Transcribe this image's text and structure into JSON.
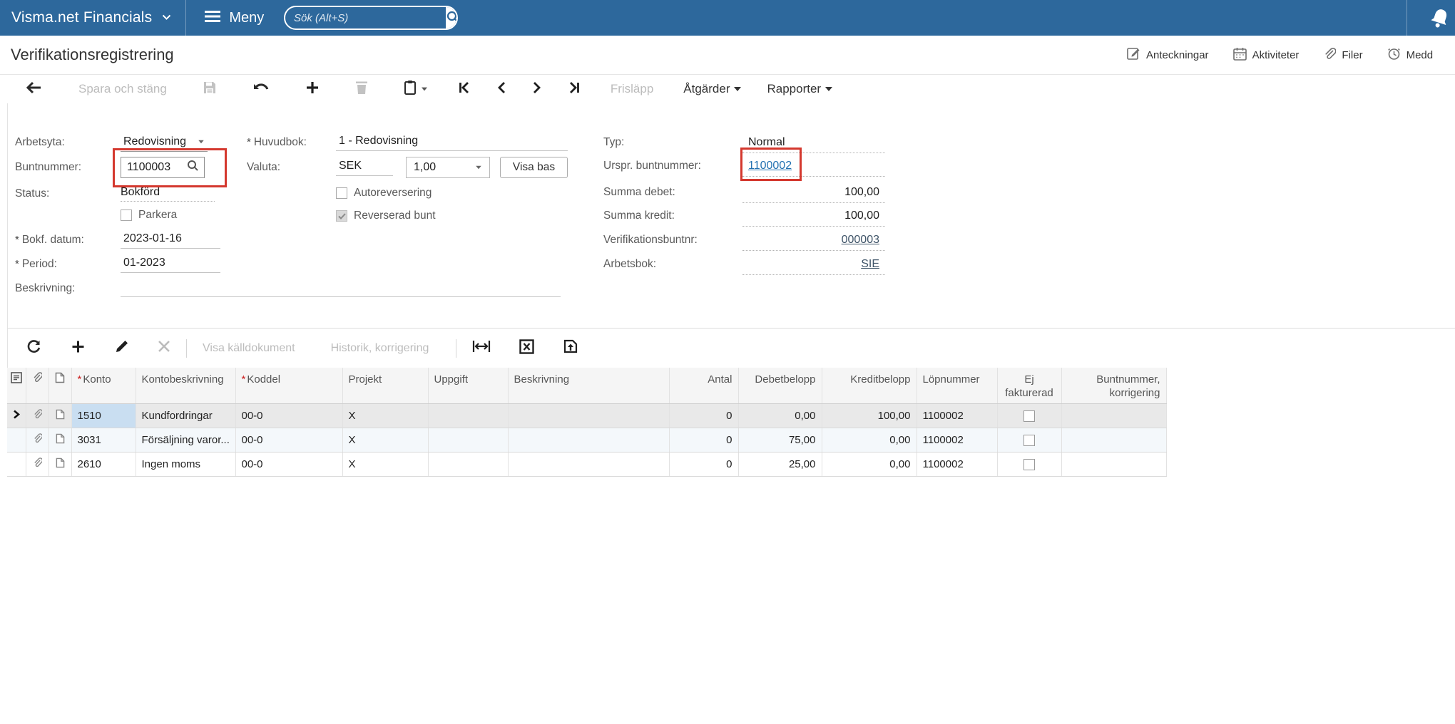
{
  "topbar": {
    "brand": "Visma.net Financials",
    "menu_label": "Meny",
    "search_placeholder": "Sök (Alt+S)"
  },
  "titlebar": {
    "title": "Verifikationsregistrering",
    "notes_label": "Anteckningar",
    "activities_label": "Aktiviteter",
    "files_label": "Filer",
    "messages_label": "Medd"
  },
  "toolbar": {
    "save_close_label": "Spara och stäng",
    "release_label": "Frisläpp",
    "actions_label": "Åtgärder",
    "reports_label": "Rapporter"
  },
  "misc": {
    "required_mark": "*"
  },
  "form": {
    "left": {
      "arbetsyta_label": "Arbetsyta:",
      "arbetsyta_value": "Redovisning",
      "buntnummer_label": "Buntnummer:",
      "buntnummer_value": "1100003",
      "status_label": "Status:",
      "status_value": "Bokförd",
      "parkera_label": "Parkera",
      "bokf_datum_label": "Bokf. datum:",
      "bokf_datum_value": "2023-01-16",
      "period_label": "Period:",
      "period_value": "01-2023",
      "beskrivning_label": "Beskrivning:",
      "beskrivning_value": ""
    },
    "middle": {
      "huvudbok_label": "Huvudbok:",
      "huvudbok_value": "1 - Redovisning",
      "valuta_label": "Valuta:",
      "valuta_currency": "SEK",
      "valuta_rate": "1,00",
      "visa_bas_label": "Visa bas",
      "autoreversering_label": "Autoreversering",
      "reverserad_bunt_label": "Reverserad bunt"
    },
    "right": {
      "typ_label": "Typ:",
      "typ_value": "Normal",
      "urspr_buntnummer_label": "Urspr. buntnummer:",
      "urspr_buntnummer_value": "1100002",
      "summa_debet_label": "Summa debet:",
      "summa_debet_value": "100,00",
      "summa_kredit_label": "Summa kredit:",
      "summa_kredit_value": "100,00",
      "verifikationsbuntnr_label": "Verifikationsbuntnr:",
      "verifikationsbuntnr_value": "000003",
      "arbetsbok_label": "Arbetsbok:",
      "arbetsbok_value": "SIE"
    }
  },
  "grid_toolbar": {
    "view_source_label": "Visa källdokument",
    "history_label": "Historik, korrigering"
  },
  "table": {
    "headers": {
      "konto": "Konto",
      "kontobeskrivning": "Kontobeskrivning",
      "koddel": "Koddel",
      "projekt": "Projekt",
      "uppgift": "Uppgift",
      "beskrivning": "Beskrivning",
      "antal": "Antal",
      "debet": "Debetbelopp",
      "kredit": "Kreditbelopp",
      "lopnummer": "Löpnummer",
      "ej_fakturerad": "Ej fakturerad",
      "buntnummer_korrigering": "Buntnummer, korrigering"
    },
    "rows": [
      {
        "konto": "1510",
        "kontobeskrivning": "Kundfordringar",
        "koddel": "00-0",
        "projekt": "X",
        "uppgift": "",
        "beskrivning": "",
        "antal": "0",
        "debet": "0,00",
        "kredit": "100,00",
        "lopnummer": "1100002"
      },
      {
        "konto": "3031",
        "kontobeskrivning": "Försäljning varor...",
        "koddel": "00-0",
        "projekt": "X",
        "uppgift": "",
        "beskrivning": "",
        "antal": "0",
        "debet": "75,00",
        "kredit": "0,00",
        "lopnummer": "1100002"
      },
      {
        "konto": "2610",
        "kontobeskrivning": "Ingen moms",
        "koddel": "00-0",
        "projekt": "X",
        "uppgift": "",
        "beskrivning": "",
        "antal": "0",
        "debet": "25,00",
        "kredit": "0,00",
        "lopnummer": "1100002"
      }
    ]
  },
  "colors": {
    "topbar": "#2d689c",
    "link": "#2372b2",
    "annotation": "#d4382e"
  }
}
